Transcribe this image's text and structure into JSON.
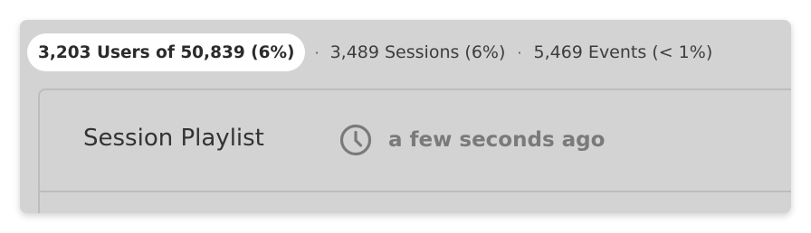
{
  "stats": {
    "users": "3,203 Users of 50,839 (6%)",
    "separator_1": "·",
    "sessions": "3,489 Sessions (6%)",
    "separator_2": "·",
    "events": "5,469 Events (< 1%)"
  },
  "panel": {
    "title": "Session Playlist",
    "time_icon": "clock-icon",
    "timestamp": "a few seconds ago"
  }
}
